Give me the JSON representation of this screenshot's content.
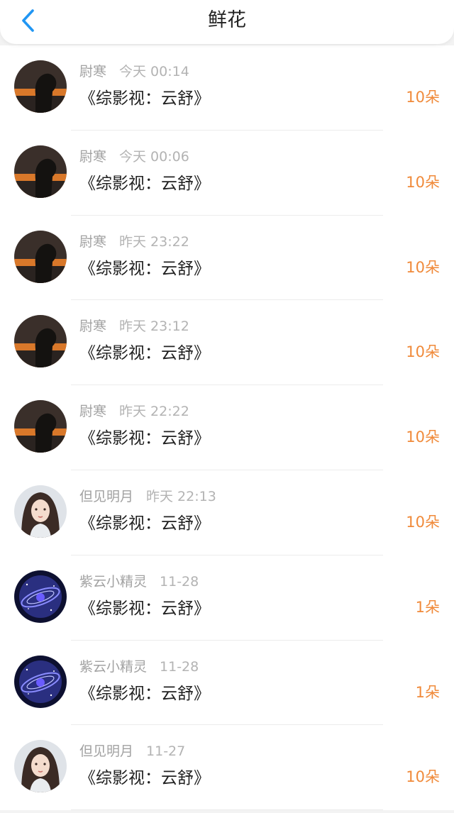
{
  "header": {
    "title": "鲜花",
    "back_icon": "chevron-left-icon",
    "accent_color": "#2196f3"
  },
  "colors": {
    "amount": "#f08a3a"
  },
  "records": [
    {
      "avatar": "sunset-silhouette",
      "user": "尉寒",
      "time": "今天 00:14",
      "book": "《综影视：云舒》",
      "amount": "10朵"
    },
    {
      "avatar": "sunset-silhouette",
      "user": "尉寒",
      "time": "今天 00:06",
      "book": "《综影视：云舒》",
      "amount": "10朵"
    },
    {
      "avatar": "sunset-silhouette",
      "user": "尉寒",
      "time": "昨天 23:22",
      "book": "《综影视：云舒》",
      "amount": "10朵"
    },
    {
      "avatar": "sunset-silhouette",
      "user": "尉寒",
      "time": "昨天 23:12",
      "book": "《综影视：云舒》",
      "amount": "10朵"
    },
    {
      "avatar": "sunset-silhouette",
      "user": "尉寒",
      "time": "昨天 22:22",
      "book": "《综影视：云舒》",
      "amount": "10朵"
    },
    {
      "avatar": "girl-portrait",
      "user": "但见明月",
      "time": "昨天 22:13",
      "book": "《综影视：云舒》",
      "amount": "10朵"
    },
    {
      "avatar": "purple-galaxy",
      "user": "紫云小精灵",
      "time": "11-28",
      "book": "《综影视：云舒》",
      "amount": "1朵"
    },
    {
      "avatar": "purple-galaxy",
      "user": "紫云小精灵",
      "time": "11-28",
      "book": "《综影视：云舒》",
      "amount": "1朵"
    },
    {
      "avatar": "girl-portrait",
      "user": "但见明月",
      "time": "11-27",
      "book": "《综影视：云舒》",
      "amount": "10朵"
    }
  ]
}
